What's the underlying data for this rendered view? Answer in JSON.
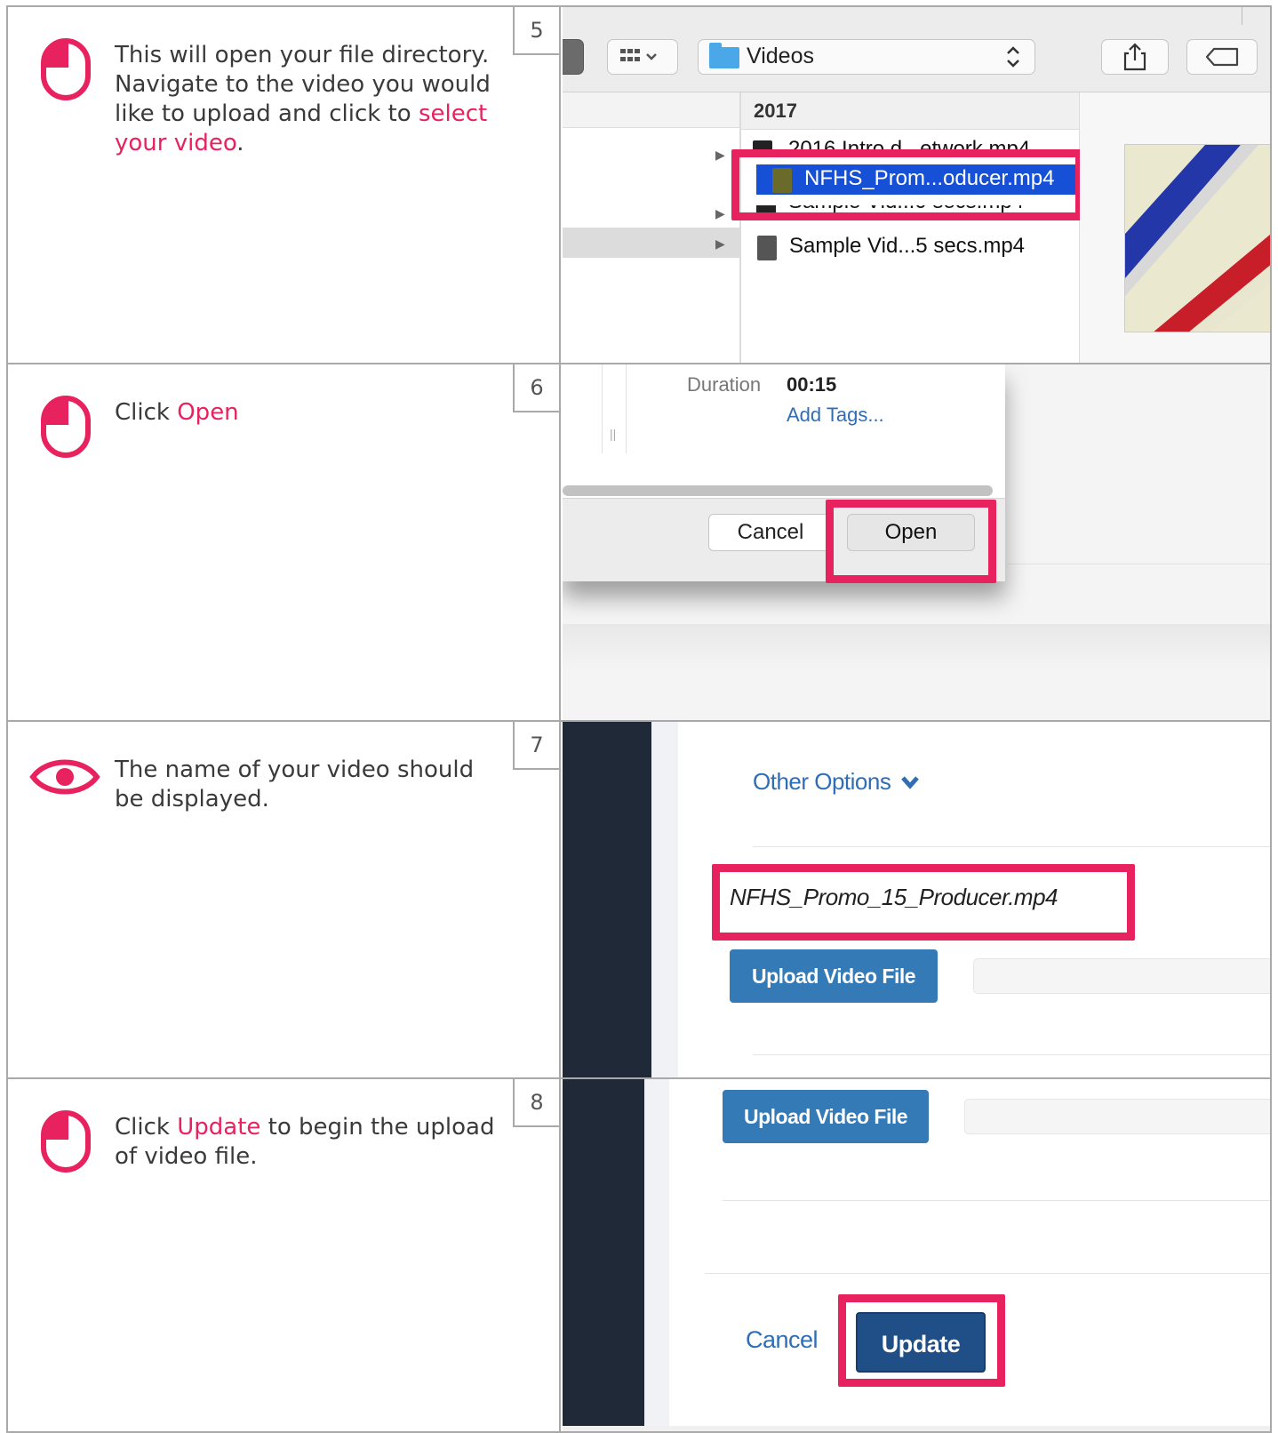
{
  "steps": [
    {
      "number": "5",
      "icon": "mouse-click-icon",
      "text_before": "This will open your file directory. Navigate to the video you would like to upload and click to ",
      "highlight": "select your video",
      "text_after": "."
    },
    {
      "number": "6",
      "icon": "mouse-click-icon",
      "text_before": "Click ",
      "highlight": "Open",
      "text_after": ""
    },
    {
      "number": "7",
      "icon": "eye-icon",
      "text_before": "The name of your video should be displayed.",
      "highlight": "",
      "text_after": ""
    },
    {
      "number": "8",
      "icon": "mouse-click-icon",
      "text_before": "Click ",
      "highlight": "Update",
      "text_after": " to begin the upload of video file."
    }
  ],
  "dialog": {
    "folder": "Videos",
    "year": "2017",
    "files": [
      "2016 Intro d...etwork.mp4",
      "NFHS_Prom...oducer.mp4",
      "Sample Vid...0 secs.mp4",
      "Sample Vid...5 secs.mp4"
    ],
    "duration_label": "Duration",
    "duration_value": "00:15",
    "add_tags": "Add Tags...",
    "cancel": "Cancel",
    "open": "Open"
  },
  "form": {
    "other_options": "Other Options",
    "filename": "NFHS_Promo_15_Producer.mp4",
    "upload_button": "Upload Video File",
    "cancel": "Cancel",
    "update": "Update"
  },
  "colors": {
    "accent": "#e8215f",
    "selection": "#1550d6",
    "button_blue": "#337ab7",
    "button_dark_blue": "#1f4f86",
    "link_blue": "#2f6db5",
    "sidebar": "#1f2937"
  }
}
